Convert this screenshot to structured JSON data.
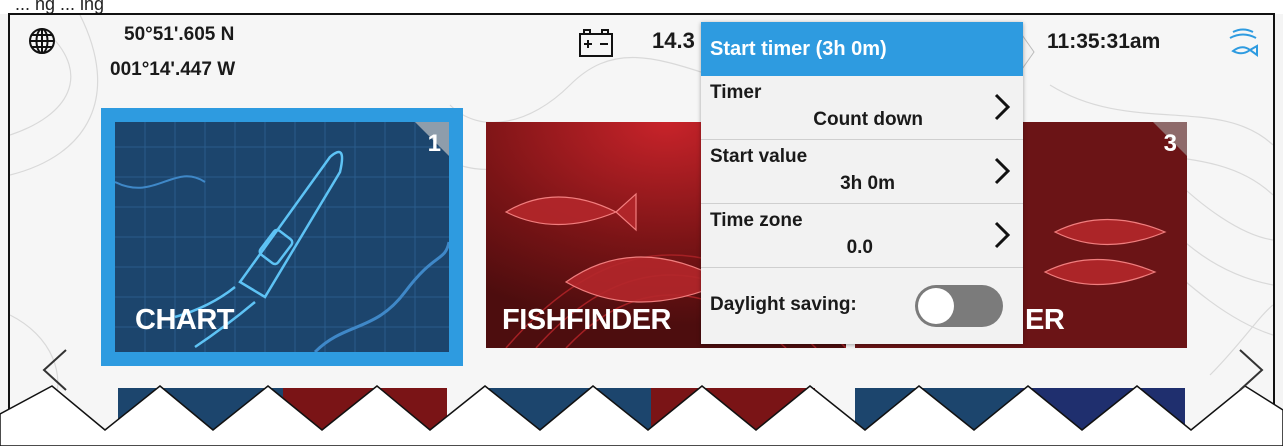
{
  "caption_fragment": "... ng ... ing",
  "status": {
    "latitude": "50°51'.605 N",
    "longitude": "001°14'.447 W",
    "voltage": "14.3",
    "time": "11:35:31am",
    "icons": [
      "globe-icon",
      "battery-icon",
      "fish-icon"
    ]
  },
  "tiles": [
    {
      "label": "CHART",
      "number": "1"
    },
    {
      "label": "FISHFINDER",
      "number": ""
    },
    {
      "label": "ER",
      "number": "3"
    }
  ],
  "menu": {
    "header": "Start timer (3h 0m)",
    "rows": [
      {
        "label": "Timer",
        "value": "Count down"
      },
      {
        "label": "Start value",
        "value": "3h 0m"
      },
      {
        "label": "Time zone",
        "value": "0.0"
      }
    ],
    "toggle_label": "Daylight saving:",
    "toggle_on": false
  },
  "colors": {
    "accent": "#2e9be0",
    "chart_tile": "#1e4e78",
    "fishfinder_tile": "#6b1212",
    "selected_border": "#2e9be0"
  }
}
